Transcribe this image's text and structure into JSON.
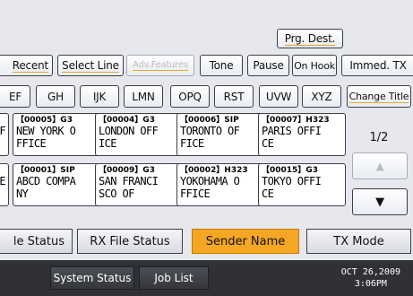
{
  "header": {
    "prg_dest": "Prg. Dest."
  },
  "toolbar": {
    "recent": "Recent",
    "select_line": "Select Line",
    "adv_features": "Adv.Features",
    "tone": "Tone",
    "pause": "Pause",
    "on_hook": "On Hook",
    "immed_tx": "Immed. TX"
  },
  "index_tabs": [
    "EF",
    "GH",
    "IJK",
    "LMN",
    "OPQ",
    "RST",
    "UVW",
    "XYZ"
  ],
  "change_title": "Change Title",
  "destinations": [
    {
      "code": "【00005】G3",
      "line1": "NEW YORK O",
      "line2": "FFICE"
    },
    {
      "code": "【00004】G3",
      "line1": "LONDON OFF",
      "line2": "ICE"
    },
    {
      "code": "【00006】SIP",
      "line1": "TORONTO OF",
      "line2": "FICE"
    },
    {
      "code": "【00007】H323",
      "line1": "PARIS OFFI",
      "line2": "CE"
    },
    {
      "code": "【00001】SIP",
      "line1": "ABCD COMPA",
      "line2": "NY"
    },
    {
      "code": "【00009】G3",
      "line1": "SAN FRANCI",
      "line2": "SCO OF"
    },
    {
      "code": "【00002】H323",
      "line1": "YOKOHAMA O",
      "line2": "FFICE"
    },
    {
      "code": "【00015】G3",
      "line1": "TOKYO OFFI",
      "line2": "CE"
    }
  ],
  "left_partial": [
    "F",
    "E"
  ],
  "pager": {
    "page": "1/2",
    "up": "▲",
    "down": "▼"
  },
  "bottom_tabs": {
    "tx_file_status": "le Status",
    "rx_file_status": "RX File Status",
    "sender_name": "Sender Name",
    "tx_mode": "TX Mode"
  },
  "status": {
    "system_status": "System Status",
    "job_list": "Job List",
    "date": "OCT  26,2009",
    "time": "3:06PM"
  }
}
